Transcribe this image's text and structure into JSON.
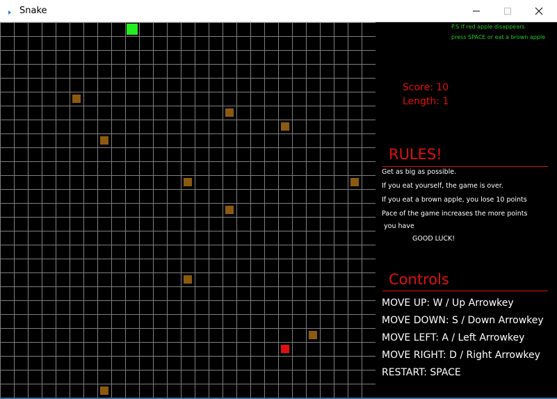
{
  "window": {
    "title": "Snake",
    "controls": [
      "minimize-icon",
      "maximize-icon",
      "close-icon"
    ]
  },
  "board": {
    "columns": 27,
    "rows": 27,
    "colors": {
      "background": "#000000",
      "grid": "#7f7f7f",
      "snake": "#22ee22",
      "red_apple": "#e01010",
      "brown_apple": "#8b5a10"
    },
    "snake": [
      [
        9,
        0
      ]
    ],
    "red_apple": [
      20,
      23
    ],
    "brown_apples": [
      [
        5,
        5
      ],
      [
        16,
        6
      ],
      [
        20,
        7
      ],
      [
        7,
        8
      ],
      [
        13,
        11
      ],
      [
        25,
        11
      ],
      [
        16,
        13
      ],
      [
        13,
        18
      ],
      [
        22,
        22
      ],
      [
        7,
        26
      ]
    ]
  },
  "panel": {
    "note_line1": "P.S If red apple disappears",
    "note_line2": "press SPACE or eat a brown apple",
    "score": "Score: 10",
    "length": "Length: 1",
    "rules_heading": "RULES!",
    "rules": [
      "Get as big as possible.",
      "If you eat yourself, the game is over.",
      "If you eat a brown apple, you lose 10 points",
      "Pace of the game increases the more points",
      " you have",
      "GOOD LUCK!"
    ],
    "controls_heading": "Controls",
    "controls": [
      "MOVE UP: W / Up Arrowkey",
      "MOVE DOWN: S / Down Arrowkey",
      "MOVE LEFT: A / Left Arrowkey",
      "MOVE RIGHT: D / Right Arrowkey",
      "RESTART: SPACE"
    ]
  }
}
